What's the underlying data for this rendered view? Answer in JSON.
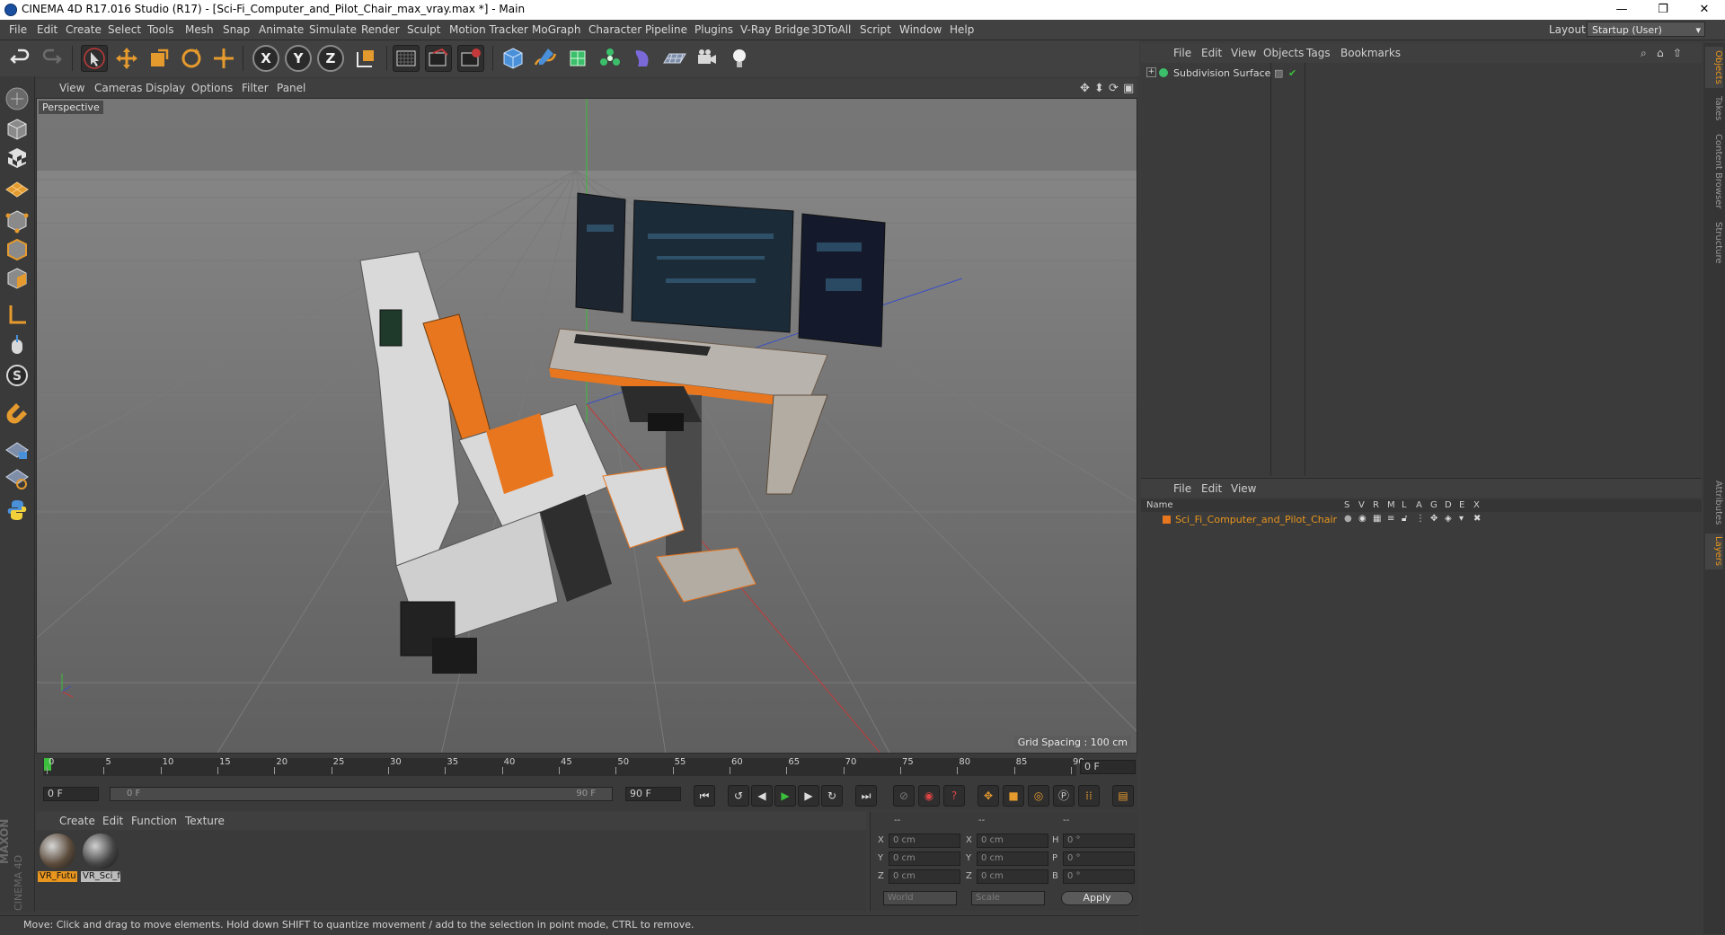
{
  "window": {
    "title": "CINEMA 4D R17.016 Studio (R17) - [Sci-Fi_Computer_and_Pilot_Chair_max_vray.max *] - Main",
    "controls": {
      "minimize": "—",
      "restore": "❐",
      "close": "✕"
    }
  },
  "menubar": {
    "items": [
      "File",
      "Edit",
      "Create",
      "Select",
      "Tools",
      "Mesh",
      "Snap",
      "Animate",
      "Simulate",
      "Render",
      "Sculpt",
      "Motion Tracker",
      "MoGraph",
      "Character",
      "Pipeline",
      "Plugins",
      "V-Ray Bridge",
      "3DToAll",
      "Script",
      "Window",
      "Help"
    ],
    "layout_label": "Layout:",
    "layout_value": "Startup (User)"
  },
  "toolbar": {
    "icons": [
      "undo-icon",
      "redo-icon",
      "live-selection-icon",
      "move-icon",
      "scale-icon",
      "rotate-icon",
      "recent-tool-icon",
      "x-axis-icon",
      "y-axis-icon",
      "z-axis-icon",
      "coordinate-system-icon",
      "render-view-icon",
      "render-picture-viewer-icon",
      "edit-render-settings-icon",
      "cube-icon",
      "pen-icon",
      "subdivision-icon",
      "array-icon",
      "deformer-icon",
      "floor-icon",
      "camera-icon",
      "light-icon"
    ],
    "axis_x": "X",
    "axis_y": "Y",
    "axis_z": "Z"
  },
  "viewport": {
    "menu": [
      "View",
      "Cameras",
      "Display",
      "Options",
      "Filter",
      "Panel"
    ],
    "label": "Perspective",
    "grid_spacing": "Grid Spacing : 100 cm"
  },
  "timeline": {
    "ticks": [
      "0",
      "5",
      "10",
      "15",
      "20",
      "25",
      "30",
      "35",
      "40",
      "45",
      "50",
      "55",
      "60",
      "65",
      "70",
      "75",
      "80",
      "85",
      "90"
    ],
    "current_frame": "0 F",
    "start_field": "0 F",
    "range_start": "0 F",
    "range_end": "90 F",
    "end_field": "90 F"
  },
  "material_manager": {
    "menu": [
      "Create",
      "Edit",
      "Function",
      "Texture"
    ],
    "materials": [
      {
        "label": "VR_Futu"
      },
      {
        "label": "VR_Sci_f"
      }
    ],
    "brand_top": "MAXON",
    "brand_bottom": "CINEMA 4D"
  },
  "coordinates": {
    "headers": [
      "--",
      "--",
      "--"
    ],
    "rows": [
      {
        "a": "X",
        "av": "0 cm",
        "b": "X",
        "bv": "0 cm",
        "c": "H",
        "cv": "0 °"
      },
      {
        "a": "Y",
        "av": "0 cm",
        "b": "Y",
        "bv": "0 cm",
        "c": "P",
        "cv": "0 °"
      },
      {
        "a": "Z",
        "av": "0 cm",
        "b": "Z",
        "bv": "0 cm",
        "c": "B",
        "cv": "0 °"
      }
    ],
    "space_select": "World",
    "mode_select": "Scale",
    "apply": "Apply"
  },
  "object_manager": {
    "menu": [
      "File",
      "Edit",
      "View",
      "Objects",
      "Tags",
      "Bookmarks"
    ],
    "items": [
      {
        "name": "Subdivision Surface"
      }
    ]
  },
  "layer_manager": {
    "menu": [
      "File",
      "Edit",
      "View"
    ],
    "columns": [
      "Name",
      "S",
      "V",
      "R",
      "M",
      "L",
      "A",
      "G",
      "D",
      "E",
      "X"
    ],
    "items": [
      {
        "name": "Sci_Fi_Computer_and_Pilot_Chair"
      }
    ]
  },
  "right_tabs": [
    "Objects",
    "Takes",
    "Content Browser",
    "Structure",
    "Attributes",
    "Layers"
  ],
  "status": {
    "text": "Move: Click and drag to move elements. Hold down SHIFT to quantize movement / add to the selection in point mode, CTRL to remove."
  },
  "colors": {
    "accent_orange": "#e8761e",
    "axis_green": "#3cbf3c",
    "axis_red": "#c43a3a",
    "axis_blue": "#3a4fc4"
  }
}
